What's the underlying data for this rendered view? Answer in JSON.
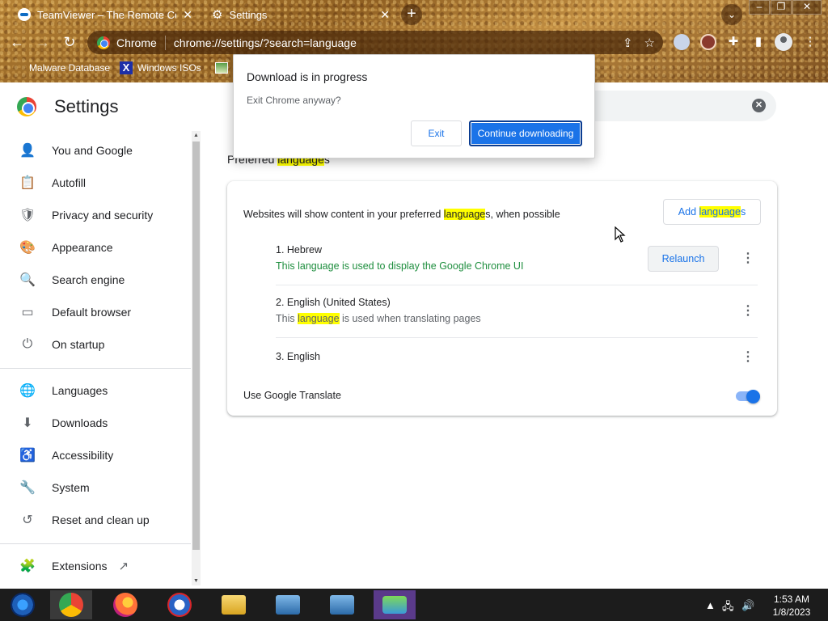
{
  "browser": {
    "tabs": [
      {
        "title": "TeamViewer – The Remote Connectivity Software",
        "icon": "teamviewer-icon"
      },
      {
        "title": "Settings",
        "icon": "gear-icon"
      }
    ],
    "omnibox": {
      "site_label": "Chrome",
      "url": "chrome://settings/?search=language"
    },
    "bookmarks": [
      {
        "label": "Malware Database",
        "icon": "bookmark-icon"
      },
      {
        "label": "Windows ISOs",
        "icon": "x-icon"
      }
    ]
  },
  "settings": {
    "title": "Settings",
    "sidebar": [
      {
        "label": "You and Google",
        "icon": "person-icon"
      },
      {
        "label": "Autofill",
        "icon": "clipboard-icon"
      },
      {
        "label": "Privacy and security",
        "icon": "shield-icon"
      },
      {
        "label": "Appearance",
        "icon": "palette-icon"
      },
      {
        "label": "Search engine",
        "icon": "search-icon"
      },
      {
        "label": "Default browser",
        "icon": "browser-icon"
      },
      {
        "label": "On startup",
        "icon": "power-icon"
      },
      {
        "label": "Languages",
        "icon": "globe-icon"
      },
      {
        "label": "Downloads",
        "icon": "download-icon"
      },
      {
        "label": "Accessibility",
        "icon": "accessibility-icon"
      },
      {
        "label": "System",
        "icon": "wrench-icon"
      },
      {
        "label": "Reset and clean up",
        "icon": "history-icon"
      },
      {
        "label": "Extensions",
        "icon": "puzzle-icon"
      }
    ],
    "section": {
      "heading_prefix": "Preferred ",
      "heading_highlight": "language",
      "heading_suffix": "s",
      "desc_prefix": "Websites will show content in your preferred ",
      "desc_highlight": "language",
      "desc_suffix": "s, when possible",
      "add_prefix": "Add ",
      "add_highlight": "language",
      "add_suffix": "s",
      "languages": [
        {
          "name": "1. Hebrew",
          "sub_prefix": "This language is used to display the Google Chrome UI",
          "sub_highlight": "",
          "sub_suffix": "",
          "action": "Relaunch"
        },
        {
          "name": "2. English (United States)",
          "sub_prefix": "This ",
          "sub_highlight": "language",
          "sub_suffix": " is used when translating pages"
        },
        {
          "name": "3. English"
        }
      ],
      "translate_label": "Use Google Translate",
      "translate_on": true
    }
  },
  "dialog": {
    "title": "Download is in progress",
    "body": "Exit Chrome anyway?",
    "exit_label": "Exit",
    "continue_label": "Continue downloading"
  },
  "taskbar": {
    "time": "1:53 AM",
    "date": "1/8/2023"
  },
  "colors": {
    "accent": "#1a73e8",
    "highlight": "#ffff00",
    "theme": "#9a6a2a"
  }
}
